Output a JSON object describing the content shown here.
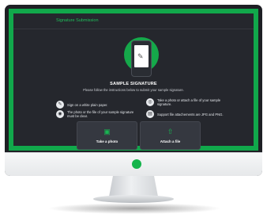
{
  "panel": {
    "title": "Signature Submission",
    "heading": "SAMPLE SIGNATURE",
    "subheading": "Please follow the instructions below to submit your sample signature."
  },
  "instructions": [
    {
      "icon": "pen-icon",
      "text": "Sign on a white plain paper."
    },
    {
      "icon": "camera-icon",
      "text": "Take a photo or attach a file of your sample signature."
    },
    {
      "icon": "eye-icon",
      "text": "The photo or the file of your sample signature must be clear."
    },
    {
      "icon": "file-icon",
      "text": "Support file attachements are JPG and PNG."
    }
  ],
  "actions": {
    "take_photo": "Take a photo",
    "attach_file": "Attach a file"
  },
  "colors": {
    "accent": "#11a84b",
    "panel": "#25272d",
    "button": "#353840"
  }
}
